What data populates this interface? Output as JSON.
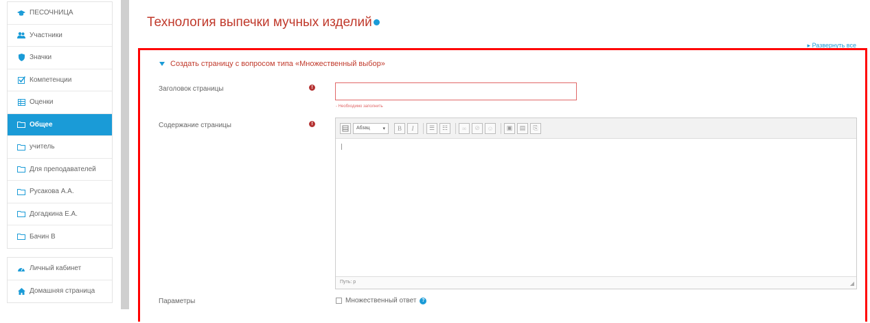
{
  "sidebar": {
    "items": [
      {
        "label": "ПЕСОЧНИЦА",
        "icon": "graduation-cap-icon",
        "active": false
      },
      {
        "label": "Участники",
        "icon": "users-icon",
        "active": false
      },
      {
        "label": "Значки",
        "icon": "shield-icon",
        "active": false
      },
      {
        "label": "Компетенции",
        "icon": "checkbox-icon",
        "active": false
      },
      {
        "label": "Оценки",
        "icon": "table-icon",
        "active": false
      },
      {
        "label": "Общее",
        "icon": "folder-icon",
        "active": true
      },
      {
        "label": "учитель",
        "icon": "folder-icon",
        "active": false
      },
      {
        "label": "Для преподавателей",
        "icon": "folder-icon",
        "active": false
      },
      {
        "label": "Русакова А.А.",
        "icon": "folder-icon",
        "active": false
      },
      {
        "label": "Догадкина Е.А.",
        "icon": "folder-icon",
        "active": false
      },
      {
        "label": "Бачин В",
        "icon": "folder-icon",
        "active": false
      }
    ],
    "items2": [
      {
        "label": "Личный кабинет",
        "icon": "dashboard-icon"
      },
      {
        "label": "Домашняя страница",
        "icon": "home-icon"
      }
    ]
  },
  "main": {
    "title": "Технология выпечки мучных изделий",
    "expand_all": "▸ Развернуть все",
    "section_heading": "Создать страницу с вопросом типа «Множественный выбор»",
    "fields": {
      "page_title_label": "Заголовок страницы",
      "required_note": "- Необходимо заполнить",
      "page_content_label": "Содержание страницы",
      "format_select": "Абзац",
      "editor_status": "Путь: p",
      "params_label": "Параметры",
      "multiple_answer_label": "Множественный ответ"
    }
  },
  "colors": {
    "accent": "#1a9bd7",
    "title": "#c0392b",
    "frame": "#ff0000",
    "required": "#b53333"
  }
}
